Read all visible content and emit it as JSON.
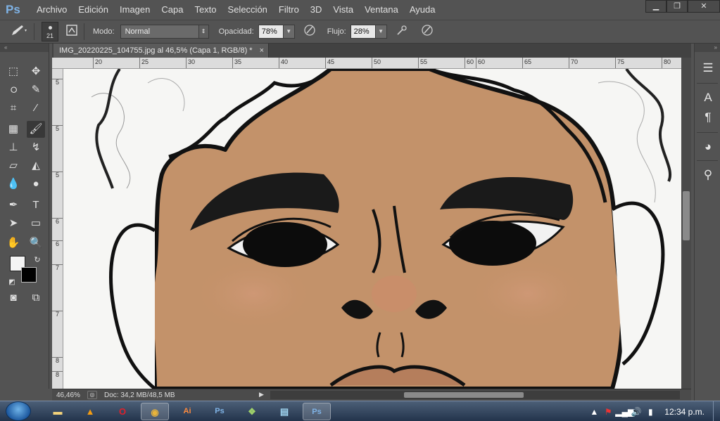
{
  "app": {
    "logo": "Ps"
  },
  "menu": [
    "Archivo",
    "Edición",
    "Imagen",
    "Capa",
    "Texto",
    "Selección",
    "Filtro",
    "3D",
    "Vista",
    "Ventana",
    "Ayuda"
  ],
  "window_controls": {
    "minimize": "▁",
    "restore": "❐",
    "close": "✕"
  },
  "options": {
    "brush_size": "21",
    "mode_label": "Modo:",
    "mode_value": "Normal",
    "opacity_label": "Opacidad:",
    "opacity_value": "78%",
    "flow_label": "Flujo:",
    "flow_value": "28%"
  },
  "document": {
    "tab_title": "IMG_20220225_104755.jpg al 46,5% (Capa 1, RGB/8) *",
    "tab_close": "×",
    "zoom": "46,46%",
    "doc_info": "Doc: 34,2 MB/48,5 MB"
  },
  "ruler_top": [
    "20",
    "25",
    "30",
    "35",
    "40",
    "45",
    "50",
    "55",
    "60",
    "60",
    "65",
    "70",
    "75",
    "80"
  ],
  "ruler_left": [
    "5",
    "5",
    "5",
    "6",
    "6",
    "7",
    "7",
    "8",
    "8"
  ],
  "colors": {
    "foreground": "#f4f4f4",
    "background": "#000000",
    "skin": "#c08f64"
  },
  "taskbar": {
    "apps": [
      "folder",
      "vlc",
      "opera",
      "chrome",
      "Ai",
      "Ps",
      "files",
      "notes",
      "Ps"
    ],
    "clock": "12:34 p.m."
  }
}
